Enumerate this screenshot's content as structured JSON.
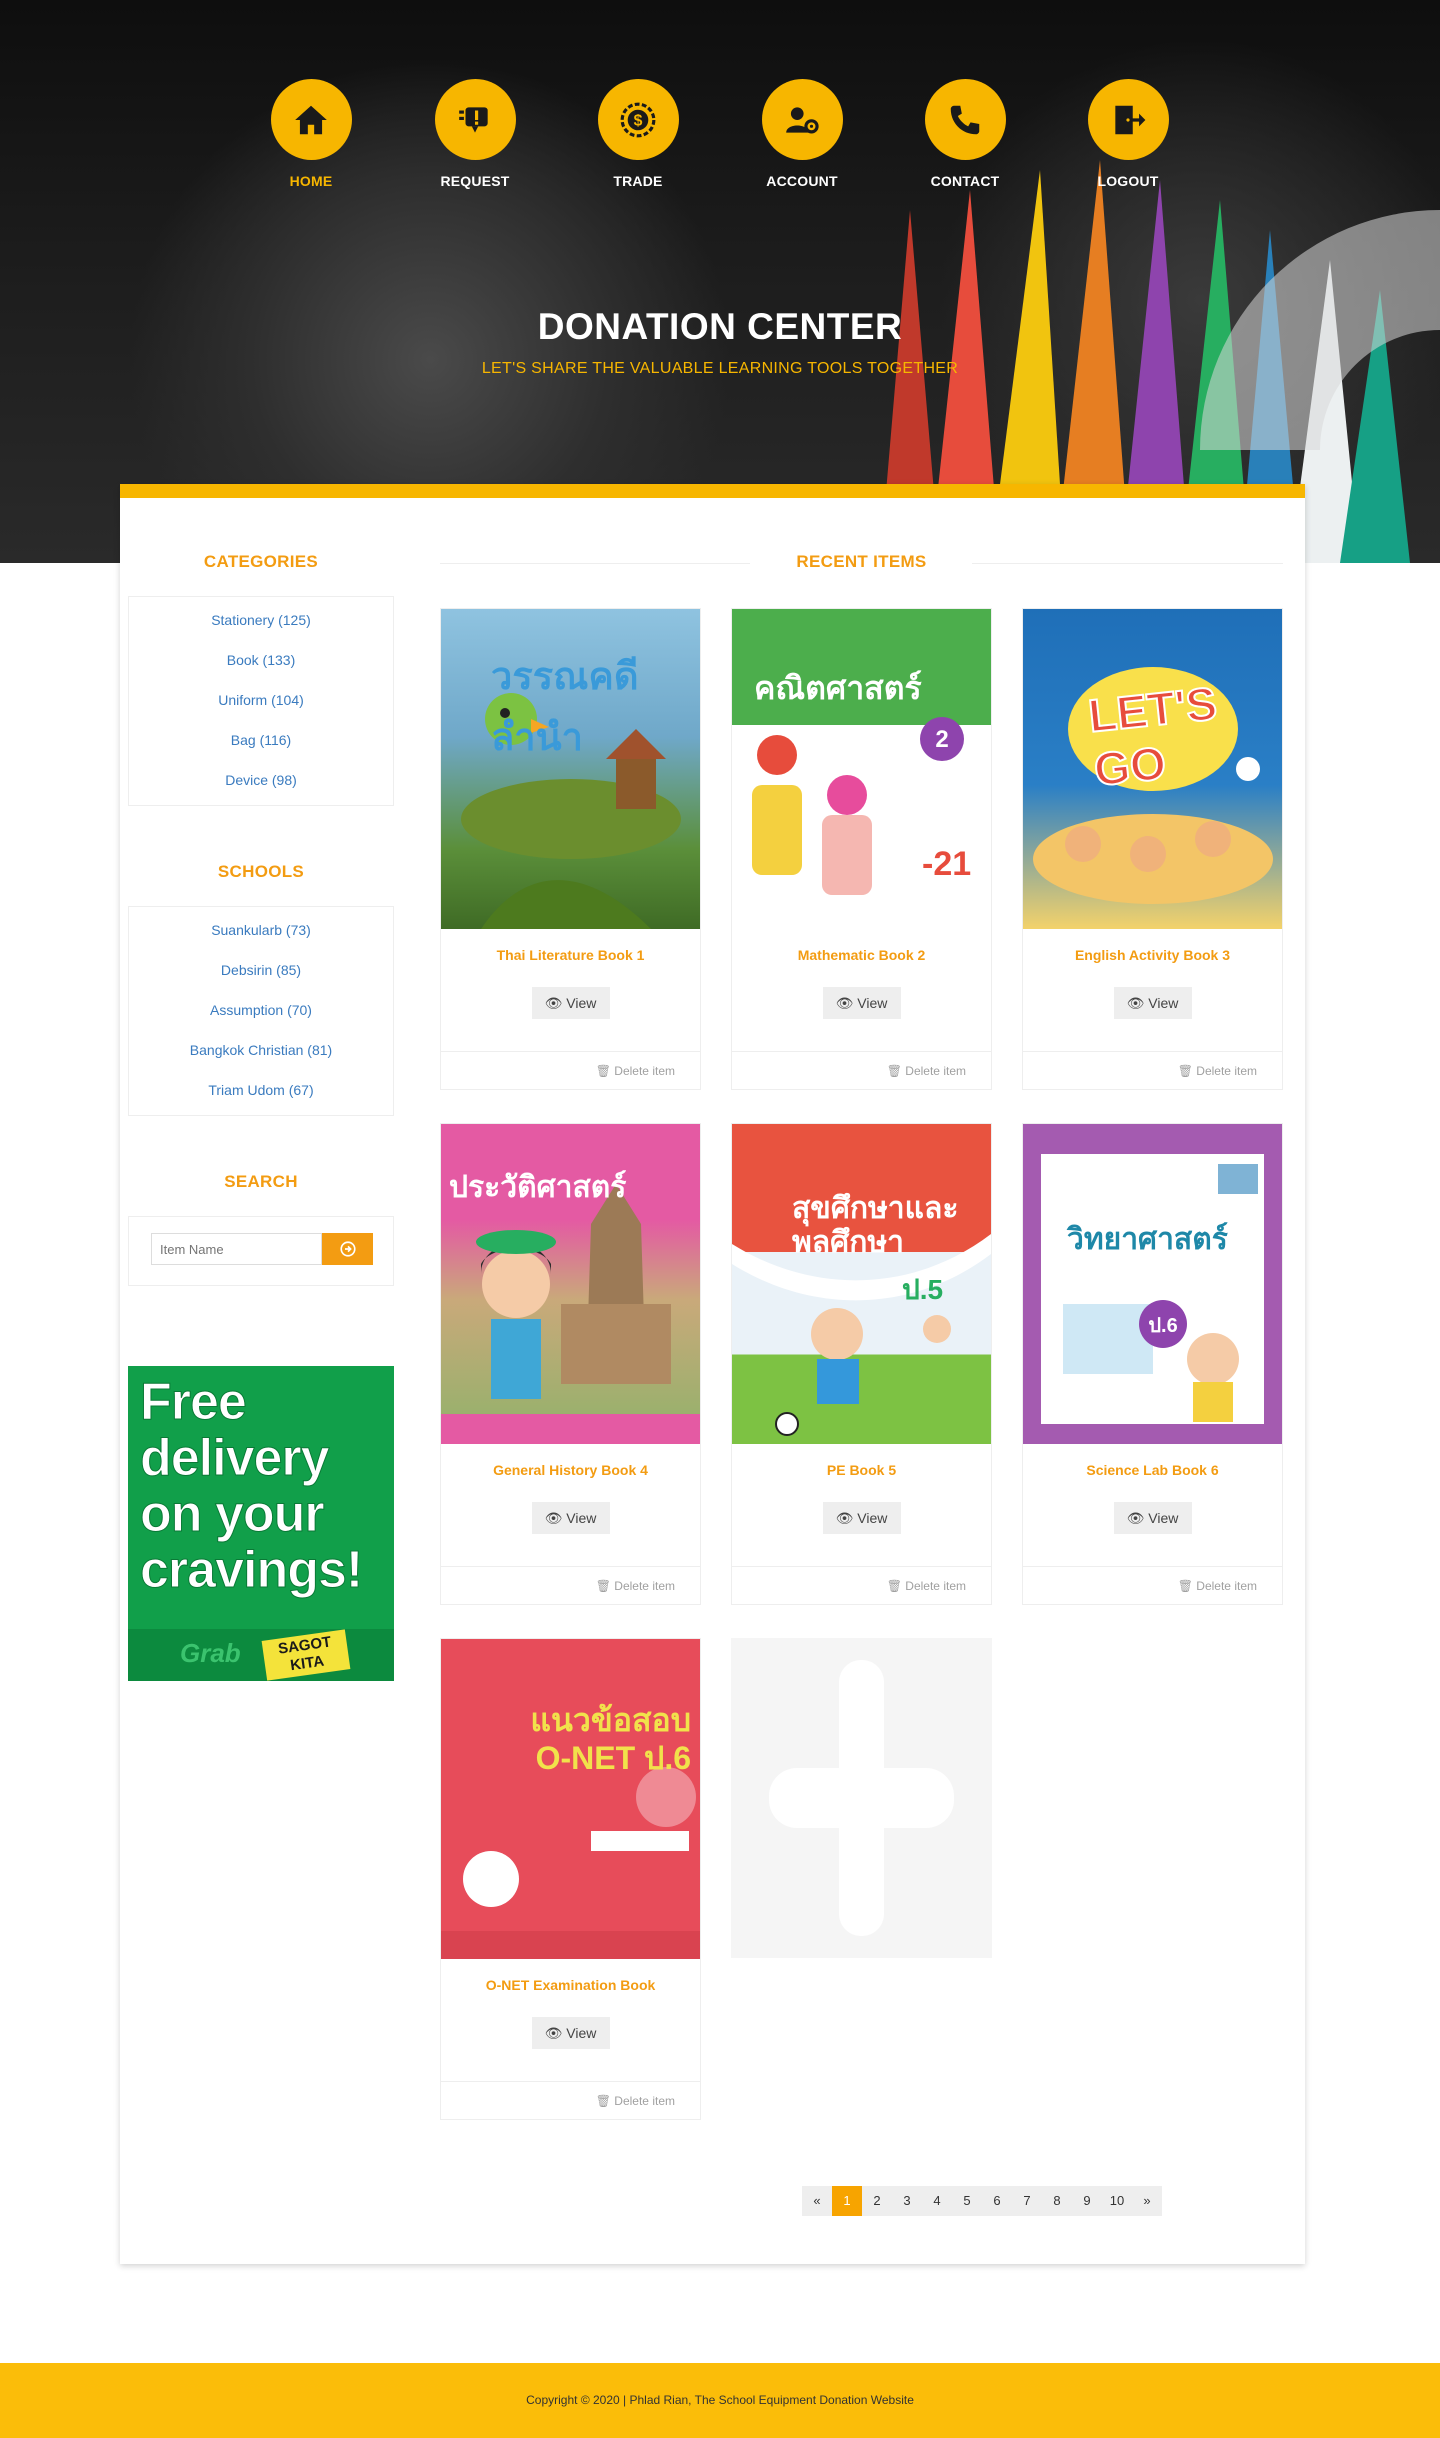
{
  "nav": [
    {
      "label": "HOME",
      "icon": "home-icon",
      "active": true
    },
    {
      "label": "REQUEST",
      "icon": "request-icon",
      "active": false
    },
    {
      "label": "TRADE",
      "icon": "trade-icon",
      "active": false
    },
    {
      "label": "ACCOUNT",
      "icon": "account-icon",
      "active": false
    },
    {
      "label": "CONTACT",
      "icon": "phone-icon",
      "active": false
    },
    {
      "label": "LOGOUT",
      "icon": "logout-icon",
      "active": false
    }
  ],
  "hero": {
    "title": "DONATION CENTER",
    "subtitle": "LET'S SHARE THE VALUABLE LEARNING TOOLS TOGETHER"
  },
  "sidebar": {
    "categories_title": "CATEGORIES",
    "categories": [
      "Stationery (125)",
      "Book (133)",
      "Uniform (104)",
      "Bag (116)",
      "Device (98)"
    ],
    "schools_title": "SCHOOLS",
    "schools": [
      "Suankularb (73)",
      "Debsirin (85)",
      "Assumption (70)",
      "Bangkok Christian (81)",
      "Triam Udom (67)"
    ],
    "search_title": "SEARCH",
    "search_placeholder": "Item Name",
    "ad_text": "Free delivery on your cravings!",
    "ad_logo": "Grab",
    "ad_sticker": "SAGOT KITA"
  },
  "recent": {
    "title": "RECENT ITEMS",
    "view_label": "View",
    "delete_label": "Delete item",
    "items": [
      {
        "title": "Thai Literature Book 1",
        "cover_text": "วรรณคดีลำนำ",
        "cover_color": "#6fa8c9"
      },
      {
        "title": "Mathematic Book 2",
        "cover_text": "คณิตศาสตร์",
        "cover_color": "#4cae4c"
      },
      {
        "title": "English Activity Book 3",
        "cover_text": "LET'S GO",
        "cover_color": "#2a7fc6"
      },
      {
        "title": "General History Book 4",
        "cover_text": "ประวัติศาสตร์",
        "cover_color": "#e45aa3"
      },
      {
        "title": "PE Book 5",
        "cover_text": "สุขศึกษาและพลศึกษา",
        "cover_color": "#e8533f"
      },
      {
        "title": "Science Lab Book 6",
        "cover_text": "วิทยาศาสตร์",
        "cover_color": "#a45bb0"
      },
      {
        "title": "O-NET Examination Book",
        "cover_text": "แนวข้อสอบ O-NET ป.6",
        "cover_color": "#e74c5a"
      }
    ]
  },
  "pagination": [
    "«",
    "1",
    "2",
    "3",
    "4",
    "5",
    "6",
    "7",
    "8",
    "9",
    "10",
    "»"
  ],
  "pagination_active": "1",
  "footer": {
    "text": "Copyright © 2020 | Phlad Rian, The School Equipment Donation Website"
  },
  "colors": {
    "accent": "#f7b600",
    "orange": "#f39c12",
    "link": "#3a7bbf",
    "footer": "#fbbd09"
  }
}
